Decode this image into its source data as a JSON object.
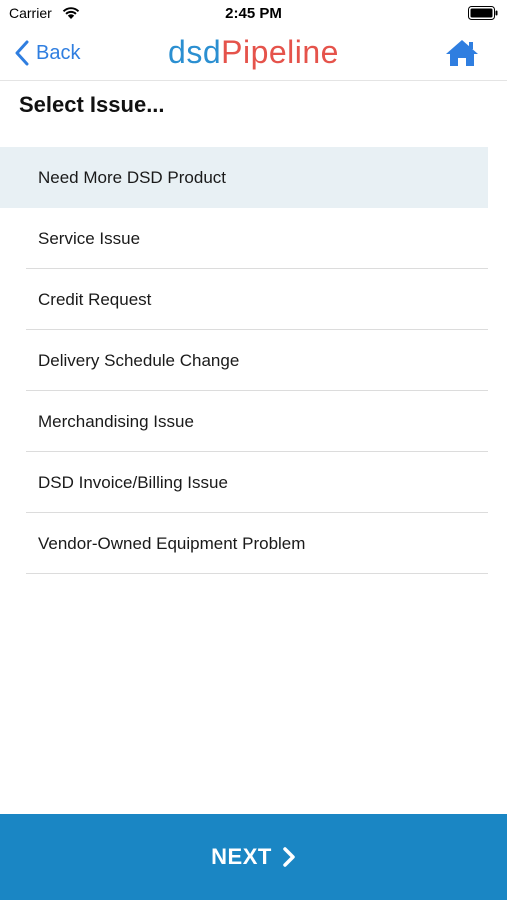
{
  "status_bar": {
    "carrier": "Carrier",
    "time": "2:45 PM"
  },
  "nav": {
    "back_label": "Back",
    "logo_part_1": "dsd",
    "logo_part_2": "Pipeline",
    "icons": {
      "back": "chevron-left-icon",
      "home": "home-icon"
    }
  },
  "page": {
    "title": "Select Issue..."
  },
  "issues": {
    "selected_index": 0,
    "items": [
      {
        "label": "Need More DSD Product"
      },
      {
        "label": "Service Issue"
      },
      {
        "label": "Credit Request"
      },
      {
        "label": "Delivery Schedule Change"
      },
      {
        "label": "Merchandising Issue"
      },
      {
        "label": "DSD Invoice/Billing Issue"
      },
      {
        "label": "Vendor-Owned Equipment Problem"
      }
    ]
  },
  "footer": {
    "next_label": "NEXT"
  },
  "colors": {
    "accent_blue": "#2f7ee0",
    "logo_blue": "#2b8fd1",
    "logo_red": "#e5534b",
    "next_bar": "#1a86c4",
    "selected_row": "#e8f0f4"
  }
}
